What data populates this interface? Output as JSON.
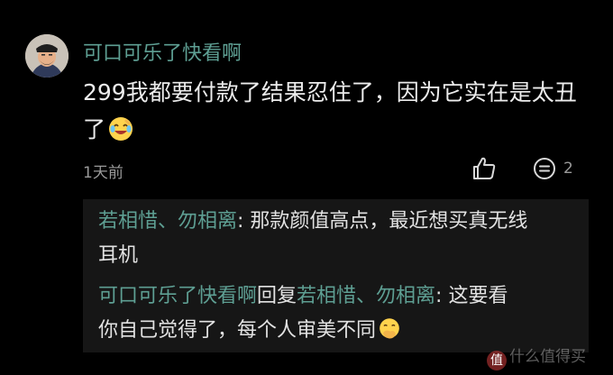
{
  "comment": {
    "username": "可口可乐了快看啊",
    "text_line1": "299我都要付款了结果忍住了，因为它实在是太丑",
    "text_line2": "了",
    "emoji": "laughing-crying-emoji",
    "time": "1天前",
    "reply_count": "2",
    "like_icon": "thumbs-up-icon",
    "reply_icon": "comment-icon"
  },
  "replies": [
    {
      "author": "若相惜、勿相离",
      "separator": ": ",
      "text_line1": "那款颜值高点，最近想买真无线",
      "text_line2": "耳机"
    },
    {
      "author": "可口可乐了快看啊",
      "reply_word": "回复",
      "target": "若相惜、勿相离",
      "separator": ": ",
      "text_line1": "这要看",
      "text_line2": "你自己觉得了，每个人审美不同",
      "emoji": "thinking-hand-over-mouth-emoji"
    }
  ],
  "watermark": {
    "badge": "值",
    "text": "什么值得买"
  },
  "colors": {
    "background": "#000000",
    "username": "#5e9f93",
    "text": "#ececec",
    "meta": "#9a9a9a",
    "reply_box": "#161616"
  }
}
